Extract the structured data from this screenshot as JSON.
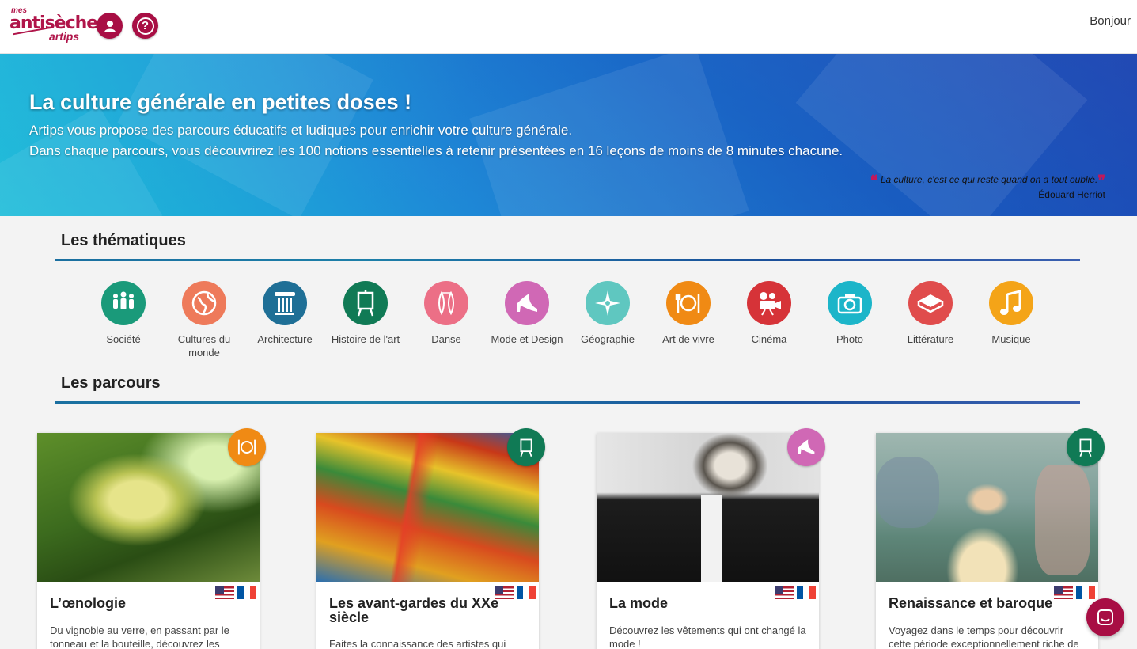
{
  "header": {
    "logo_line1": "mes",
    "logo_line2": "antisèches",
    "logo_line3": "artips",
    "greeting": "Bonjour"
  },
  "banner": {
    "title": "La culture générale en petites doses !",
    "line1": "Artips vous propose des parcours éducatifs et ludiques pour enrichir votre culture générale.",
    "line2": "Dans chaque parcours, vous découvrirez les 100 notions essentielles à retenir présentées en 16 leçons de moins de 8 minutes chacune.",
    "quote": "La culture, c'est ce qui reste quand on a tout oublié.",
    "quote_author": "Édouard Herriot"
  },
  "themes_section": {
    "title": "Les thématiques",
    "items": [
      {
        "label": "Société",
        "icon": "people-icon",
        "color": "#1a9a7a"
      },
      {
        "label": "Cultures du monde",
        "icon": "globe-icon",
        "color": "#ee7a5a"
      },
      {
        "label": "Architecture",
        "icon": "column-icon",
        "color": "#1f6f96"
      },
      {
        "label": "Histoire de l'art",
        "icon": "easel-icon",
        "color": "#107a55"
      },
      {
        "label": "Danse",
        "icon": "ballet-shoes-icon",
        "color": "#ec6f86"
      },
      {
        "label": "Mode et Design",
        "icon": "high-heel-icon",
        "color": "#d068b5"
      },
      {
        "label": "Géographie",
        "icon": "compass-rose-icon",
        "color": "#5fc7c0"
      },
      {
        "label": "Art de vivre",
        "icon": "plate-icon",
        "color": "#f08a14"
      },
      {
        "label": "Cinéma",
        "icon": "movie-camera-icon",
        "color": "#d63338"
      },
      {
        "label": "Photo",
        "icon": "camera-icon",
        "color": "#1cb5c9"
      },
      {
        "label": "Littérature",
        "icon": "book-icon",
        "color": "#e04c4c"
      },
      {
        "label": "Musique",
        "icon": "music-note-icon",
        "color": "#f4a418"
      }
    ]
  },
  "courses_section": {
    "title": "Les parcours",
    "cards": [
      {
        "title": "L’œnologie",
        "desc": "Du vignoble au verre, en passant par le tonneau et la bouteille, découvrez les",
        "badge_icon": "plate-icon",
        "badge_color": "#f08a14"
      },
      {
        "title": "Les avant-gardes du XXe siècle",
        "desc": "Faites la connaissance des artistes qui",
        "badge_icon": "easel-icon",
        "badge_color": "#107a55"
      },
      {
        "title": "La mode",
        "desc": "Découvrez les vêtements qui ont changé la mode !",
        "badge_icon": "high-heel-icon",
        "badge_color": "#d068b5"
      },
      {
        "title": "Renaissance et baroque",
        "desc": "Voyagez dans le temps pour découvrir cette période exceptionnellement riche de",
        "badge_icon": "easel-icon",
        "badge_color": "#107a55"
      }
    ]
  }
}
